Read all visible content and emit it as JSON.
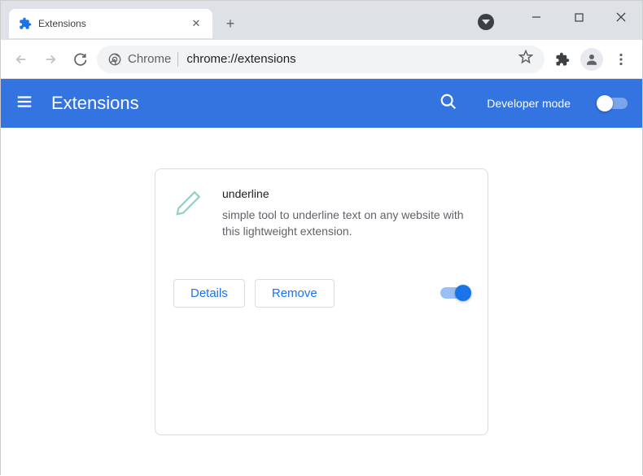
{
  "tab": {
    "title": "Extensions"
  },
  "omnibox": {
    "scheme_label": "Chrome",
    "url": "chrome://extensions"
  },
  "header": {
    "title": "Extensions",
    "dev_mode_label": "Developer mode",
    "dev_mode_on": false
  },
  "extension": {
    "name": "underline",
    "description": "simple tool to underline text on any website with this lightweight extension.",
    "details_label": "Details",
    "remove_label": "Remove",
    "enabled": true
  }
}
